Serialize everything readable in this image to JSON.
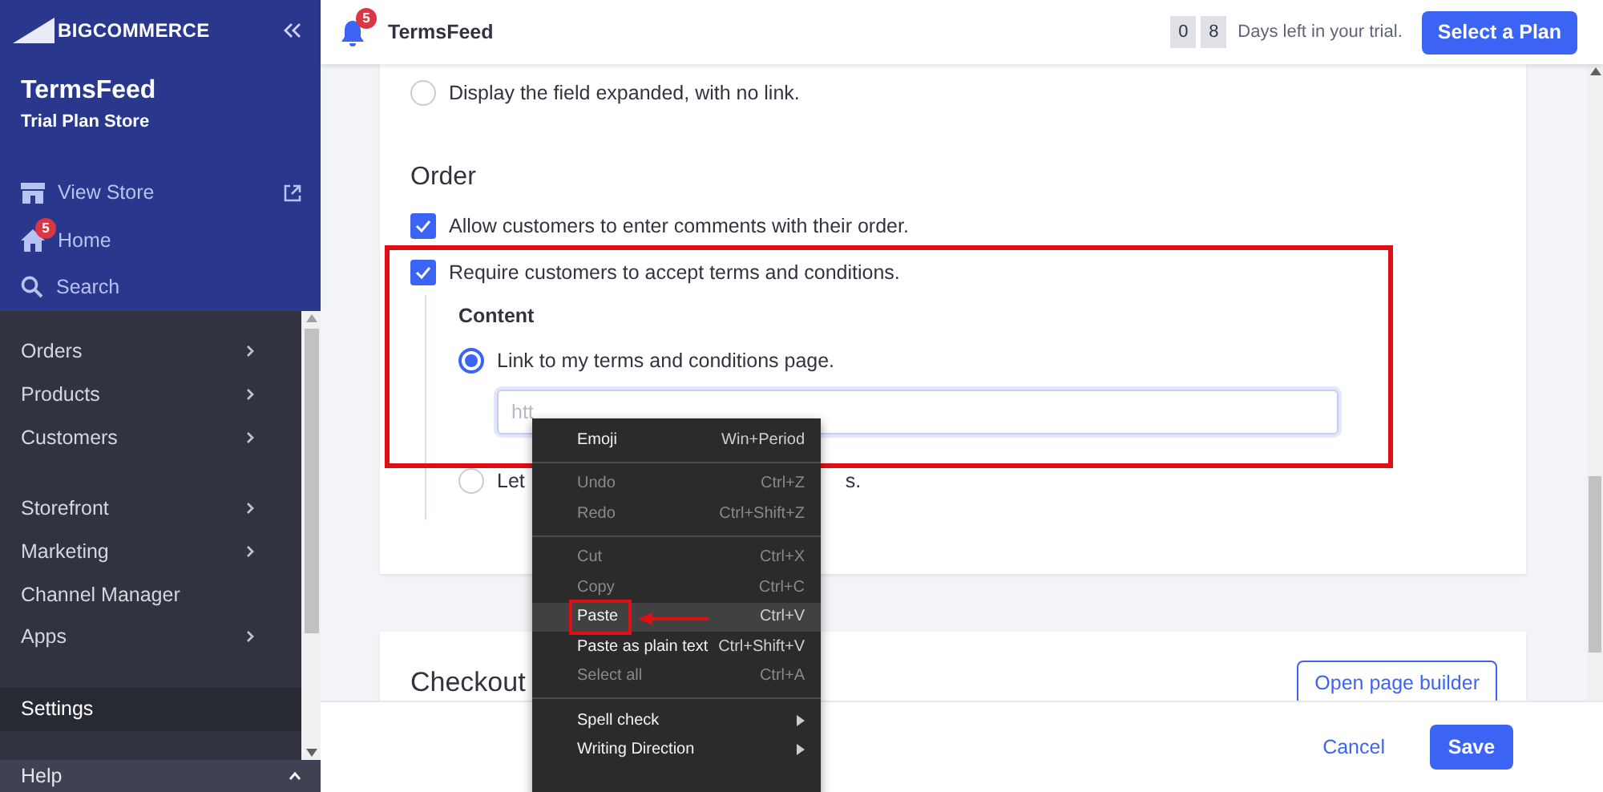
{
  "sidebar": {
    "logo": "BIGCOMMERCE",
    "store_name": "TermsFeed",
    "store_plan": "Trial Plan Store",
    "quick_links": [
      {
        "kind": "view",
        "label": "View Store"
      },
      {
        "kind": "home",
        "label": "Home",
        "badge": "5"
      },
      {
        "kind": "search",
        "label": "Search"
      }
    ],
    "nav_groups": [
      {
        "items": [
          {
            "label": "Orders",
            "has_submenu": true,
            "selected": false
          },
          {
            "label": "Products",
            "has_submenu": true,
            "selected": false
          },
          {
            "label": "Customers",
            "has_submenu": true,
            "selected": false
          }
        ]
      },
      {
        "items": [
          {
            "label": "Storefront",
            "has_submenu": true,
            "selected": false
          },
          {
            "label": "Marketing",
            "has_submenu": true,
            "selected": false
          },
          {
            "label": "Channel Manager",
            "has_submenu": false,
            "selected": false
          },
          {
            "label": "Apps",
            "has_submenu": true,
            "selected": false
          }
        ]
      },
      {
        "items": [
          {
            "label": "Settings",
            "has_submenu": false,
            "selected": true
          }
        ]
      }
    ],
    "help": {
      "label": "Help"
    }
  },
  "header": {
    "notification_count": "5",
    "store": "TermsFeed",
    "trial_digits": [
      "0",
      "8"
    ],
    "trial_text": "Days left in your trial.",
    "plan_button": "Select a Plan"
  },
  "settings_card": {
    "option": {
      "label": "Display the field expanded, with no link.",
      "selected": false
    },
    "section_title": "Order",
    "checkboxes": [
      {
        "label": "Allow customers to enter comments with their order.",
        "checked": true
      },
      {
        "label": "Require customers to accept terms and conditions.",
        "checked": true
      }
    ],
    "content": {
      "title": "Content",
      "options": [
        {
          "label": "Link to my terms and conditions page.",
          "selected": true
        },
        {
          "label": "Let",
          "tail": "s.",
          "selected": false
        }
      ],
      "url_field": {
        "placeholder": "htt"
      }
    }
  },
  "checkout_card": {
    "title": "Checkout",
    "button": "Open page builder"
  },
  "footer": {
    "cancel": "Cancel",
    "save": "Save"
  },
  "context_menu": {
    "groups": [
      {
        "items": [
          {
            "label": "Emoji",
            "shortcut": "Win+Period",
            "disabled": false,
            "selected": false,
            "has_submenu": false
          }
        ]
      },
      {
        "items": [
          {
            "label": "Undo",
            "shortcut": "Ctrl+Z",
            "disabled": true,
            "selected": false,
            "has_submenu": false
          },
          {
            "label": "Redo",
            "shortcut": "Ctrl+Shift+Z",
            "disabled": true,
            "selected": false,
            "has_submenu": false
          }
        ]
      },
      {
        "items": [
          {
            "label": "Cut",
            "shortcut": "Ctrl+X",
            "disabled": true,
            "selected": false,
            "has_submenu": false
          },
          {
            "label": "Copy",
            "shortcut": "Ctrl+C",
            "disabled": true,
            "selected": false,
            "has_submenu": false
          },
          {
            "label": "Paste",
            "shortcut": "Ctrl+V",
            "disabled": false,
            "selected": true,
            "has_submenu": false
          },
          {
            "label": "Paste as plain text",
            "shortcut": "Ctrl+Shift+V",
            "disabled": false,
            "selected": false,
            "has_submenu": false
          },
          {
            "label": "Select all",
            "shortcut": "Ctrl+A",
            "disabled": true,
            "selected": false,
            "has_submenu": false
          }
        ]
      },
      {
        "items": [
          {
            "label": "Spell check",
            "disabled": false,
            "selected": false,
            "has_submenu": true
          },
          {
            "label": "Writing Direction",
            "disabled": false,
            "selected": false,
            "has_submenu": true
          }
        ]
      }
    ]
  }
}
